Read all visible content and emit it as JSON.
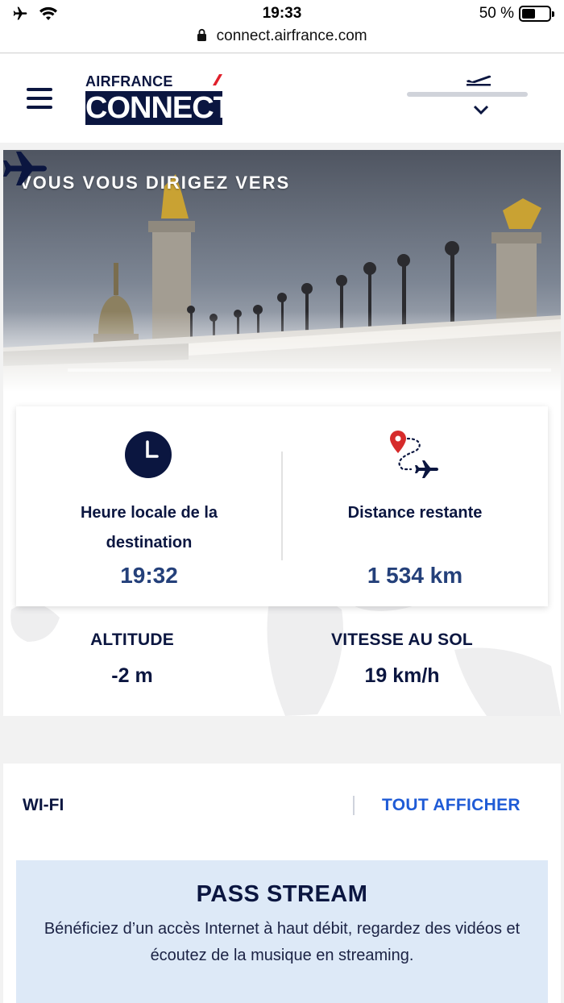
{
  "status_bar": {
    "time": "19:33",
    "battery_text": "50 %",
    "battery_level": 0.5,
    "icons": [
      "airplane-mode-icon",
      "wifi-icon",
      "battery-icon"
    ]
  },
  "browser": {
    "url": "connect.airfrance.com"
  },
  "header": {
    "logo_top": "AIRFRANCE",
    "logo_bottom": "CONNECT",
    "flight_progress": 0.0
  },
  "hero": {
    "title": "VOUS VOUS DIRIGEZ VERS"
  },
  "stats": {
    "local_time_label": "Heure locale de la destination",
    "local_time_value": "19:32",
    "distance_label": "Distance restante",
    "distance_value": "1 534 km"
  },
  "metrics": {
    "altitude_label": "ALTITUDE",
    "altitude_value": "-2 m",
    "speed_label": "VITESSE AU SOL",
    "speed_value": "19 km/h"
  },
  "wifi": {
    "section_title": "WI-FI",
    "show_all_link": "TOUT AFFICHER",
    "pass_title": "PASS STREAM",
    "pass_description": "Bénéficiez d’un accès Internet à haut débit, regardez des vidéos et écoutez de la musique en streaming."
  },
  "colors": {
    "navy": "#0b1640",
    "value_blue": "#24407a",
    "link_blue": "#1f5bd6",
    "pass_bg": "#dde9f7",
    "pin_red": "#d62b2b"
  }
}
